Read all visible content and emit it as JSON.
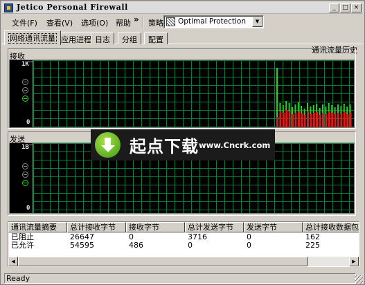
{
  "window": {
    "title": "Jetico Personal Firewall",
    "minimize": "_",
    "maximize": "□",
    "close": "×"
  },
  "menu": {
    "file": "文件(F)",
    "view": "查看(V)",
    "options": "选项(O)",
    "help": "帮助",
    "more": "»",
    "policy_label": "策略",
    "policy_value": "Optimal Protection"
  },
  "tabs": [
    "网络通讯流量",
    "应用进程",
    "日志",
    "分组",
    "配置"
  ],
  "history_label": "通讯流量历史",
  "receive": {
    "label": "接收",
    "scale_max": "1K",
    "scale_min": "0",
    "bars": [
      0.95,
      0.38,
      0.35,
      0.42,
      0.38,
      0.32,
      0.36,
      0.4,
      0.34,
      0.3,
      0.38,
      0.33,
      0.35,
      0.37,
      0.31,
      0.36,
      0.33,
      0.38,
      0.35,
      0.32,
      0.36,
      0.34,
      0.37,
      0.33,
      0.36
    ]
  },
  "send": {
    "label": "发送",
    "scale_max": "1B",
    "scale_min": "0"
  },
  "watermark": {
    "cn": "起点下载",
    "url": "www.Cncrk.com"
  },
  "table": {
    "columns": [
      "通讯流量摘要",
      "总计接收字节",
      "接收字节",
      "总计发送字节",
      "发送字节",
      "总计接收数据包"
    ],
    "rows": [
      [
        "已阻止",
        "26647",
        "0",
        "3716",
        "0",
        "162"
      ],
      [
        "已允许",
        "54595",
        "486",
        "0",
        "0",
        "225"
      ]
    ]
  },
  "status": "Ready",
  "colors": {
    "grid": "#0a7a3a",
    "bar_red": "#e01818",
    "bar_green": "#28d020"
  }
}
